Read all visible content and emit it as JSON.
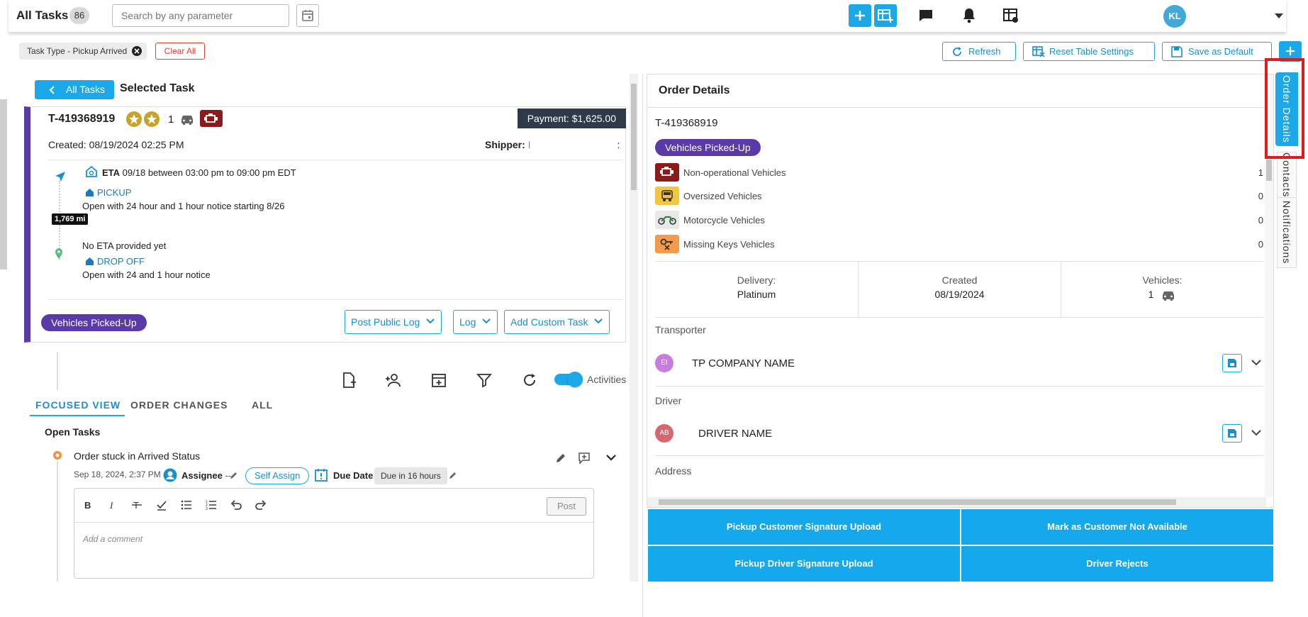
{
  "header": {
    "title": "All Tasks",
    "count": "86",
    "search_placeholder": "Search by any parameter",
    "avatar_initials": "KL"
  },
  "filters": {
    "chip_label": "Task Type - Pickup Arrived",
    "clear_all": "Clear All"
  },
  "toolbar": {
    "refresh": "Refresh",
    "reset_table": "Reset Table Settings",
    "save_default": "Save as Default"
  },
  "left": {
    "back_button": "All Tasks",
    "heading": "Selected Task",
    "task": {
      "id": "T-419368919",
      "quantity": "1",
      "payment": "Payment: $1,625.00",
      "created_label": "Created:",
      "created_value": "08/19/2024 02:25 PM",
      "shipper_label": "Shipper:",
      "shipper_value": "I",
      "shipper_tail": ":",
      "distance": "1,769 mi",
      "eta_label": "ETA",
      "eta_text": "09/18 between 03:00 pm to 09:00 pm EDT",
      "pickup_label": "PICKUP",
      "pickup_note": "Open with 24 hour and 1 hour notice starting 8/26",
      "no_eta": "No ETA provided yet",
      "dropoff_label": "DROP OFF",
      "dropoff_note": "Open with 24 and 1 hour notice",
      "status": "Vehicles Picked-Up",
      "btn_public_log": "Post Public Log",
      "btn_log": "Log",
      "btn_custom_task": "Add Custom Task"
    },
    "activities_label": "Activities",
    "tabs": [
      "FOCUSED VIEW",
      "ORDER CHANGES",
      "ALL"
    ],
    "open_tasks_heading": "Open Tasks",
    "open_task": {
      "title": "Order stuck in Arrived Status",
      "date": "Sep 18, 2024, 2:37 PM",
      "assignee_label": "Assignee",
      "assignee_value": "--",
      "self_assign": "Self Assign",
      "due_label": "Due Date",
      "due_value": "Due in 16 hours",
      "post": "Post",
      "comment_placeholder": "Add a comment"
    }
  },
  "order_details": {
    "title": "Order Details",
    "id": "T-419368919",
    "status": "Vehicles Picked-Up",
    "vehicles": [
      {
        "label": "Non-operational Vehicles",
        "count": "1",
        "color": "#8b1a1a"
      },
      {
        "label": "Oversized Vehicles",
        "count": "0",
        "color": "#f5c542"
      },
      {
        "label": "Motorcycle Vehicles",
        "count": "0",
        "color": "#e8e8e8"
      },
      {
        "label": "Missing Keys Vehicles",
        "count": "0",
        "color": "#f59a4a"
      }
    ],
    "stats": [
      {
        "key": "Delivery:",
        "value": "Platinum"
      },
      {
        "key": "Created",
        "value": "08/19/2024"
      },
      {
        "key": "Vehicles:",
        "value": "1"
      }
    ],
    "transporter_label": "Transporter",
    "transporter_initials": "EI",
    "transporter_name": "TP COMPANY NAME",
    "driver_label": "Driver",
    "driver_initials": "AB",
    "driver_name": "DRIVER NAME",
    "address_label": "Address"
  },
  "actions": {
    "pickup_customer_sig": "Pickup Customer Signature Upload",
    "customer_not_available": "Mark as Customer Not Available",
    "pickup_driver_sig": "Pickup Driver Signature Upload",
    "driver_rejects": "Driver Rejects"
  },
  "side_tabs": [
    "Order Details",
    "Contacts",
    "Notifications"
  ],
  "colors": {
    "accent": "#1aa8e8",
    "status_purple": "#5a3aa8",
    "payment_bg": "#2e3a48",
    "highlight": "#e01b1b"
  }
}
